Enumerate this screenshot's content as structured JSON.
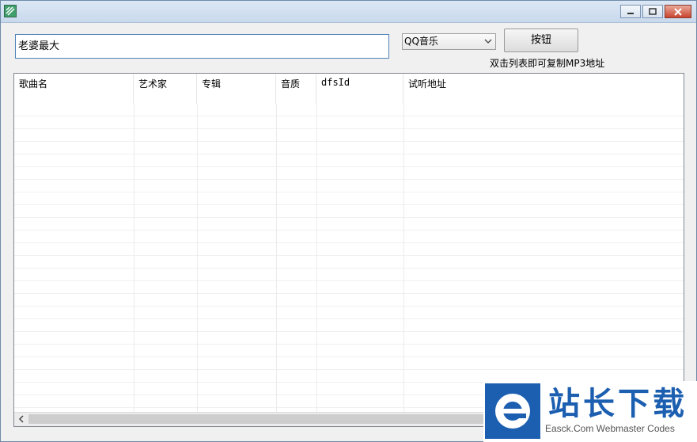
{
  "window": {
    "minimize_icon": "minimize-icon",
    "maximize_icon": "maximize-icon",
    "close_icon": "close-icon"
  },
  "search": {
    "value": "老婆最大"
  },
  "source_select": {
    "selected": "QQ音乐"
  },
  "action_button": {
    "label": "按钮"
  },
  "hint_text": "双击列表即可复制MP3地址",
  "table": {
    "columns": [
      "歌曲名",
      "艺术家",
      "专辑",
      "音质",
      "dfsId",
      "试听地址"
    ],
    "rows": []
  },
  "watermark": {
    "title": "站长下载",
    "subtitle": "Easck.Com Webmaster Codes"
  },
  "colors": {
    "titlebar": "#c9d9ec",
    "input_border": "#4f82b8",
    "close_button": "#c9452f",
    "watermark_blue": "#1c5fb1"
  }
}
